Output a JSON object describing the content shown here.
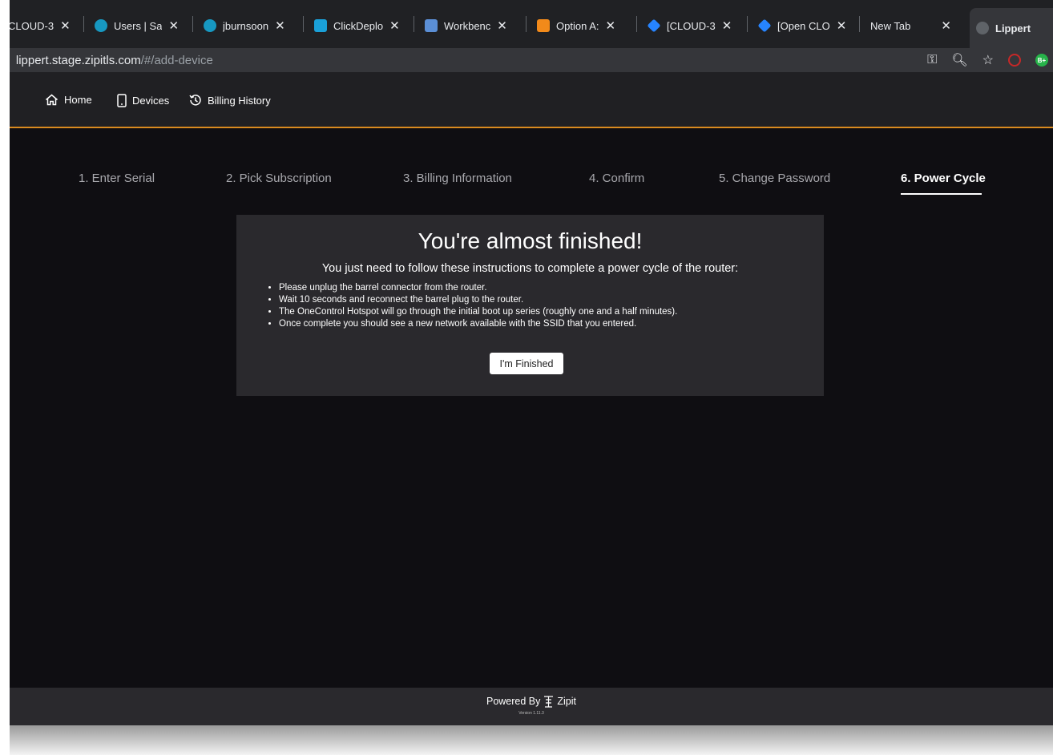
{
  "browser": {
    "tabs": [
      {
        "label": "CLOUD-3",
        "icon": "none",
        "color": "#e8eaed"
      },
      {
        "label": "Users | Sa",
        "icon": "salesforce-cloud-icon",
        "color": "#1798c1"
      },
      {
        "label": "jburnsoon",
        "icon": "salesforce-cloud-icon",
        "color": "#1798c1"
      },
      {
        "label": "ClickDeplo",
        "icon": "clickdeploy-icon",
        "color": "#1aa0d8"
      },
      {
        "label": "Workbenc",
        "icon": "workbench-cube-icon",
        "color": "#5b8fd6"
      },
      {
        "label": "Option A:",
        "icon": "option-icon",
        "color": "#f28a1a"
      },
      {
        "label": "[CLOUD-3",
        "icon": "jira-diamond-icon",
        "color": "#2684ff"
      },
      {
        "label": "[Open CLO",
        "icon": "jira-diamond-icon",
        "color": "#2684ff"
      },
      {
        "label": "New Tab",
        "icon": "none",
        "color": "#e8eaed"
      },
      {
        "label": "Lippert",
        "icon": "globe-icon",
        "color": "#9aa0a6"
      }
    ],
    "url_host": "lippert.stage.zipitls.com",
    "url_path": "/#/add-device"
  },
  "nav": {
    "home": "Home",
    "devices": "Devices",
    "billing": "Billing History"
  },
  "steps": [
    "1. Enter Serial",
    "2. Pick Subscription",
    "3. Billing Information",
    "4. Confirm",
    "5. Change Password",
    "6. Power Cycle"
  ],
  "card": {
    "title": "You're almost finished!",
    "subtitle": "You just need to follow these instructions to complete a power cycle of the router:",
    "instructions": [
      "Please unplug the barrel connector from the router.",
      "Wait 10 seconds and reconnect the barrel plug to the router.",
      "The OneControl Hotspot will go through the initial boot up series (roughly one and a half minutes).",
      "Once complete you should see a new network available with the SSID that you entered."
    ],
    "button": "I'm Finished"
  },
  "footer": {
    "powered_by": "Powered By",
    "brand": "Zipit",
    "version": "Version 1.11.3"
  },
  "colors": {
    "accent_line": "#d98a1f",
    "page_bg": "#0f0e12",
    "card_bg": "#2a292d"
  }
}
